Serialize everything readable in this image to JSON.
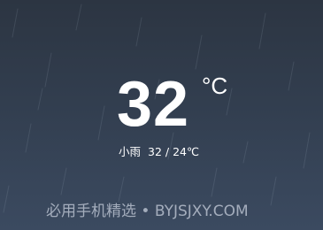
{
  "weather": {
    "temperature": "32",
    "unit": "°C",
    "condition": "小雨",
    "range": "32 / 24℃"
  },
  "watermark": {
    "text": "必用手机精选 • BYJSJXY.COM"
  },
  "colors": {
    "background_top": "#2c3542",
    "background_bottom": "#3b4a60",
    "text": "#ffffff"
  }
}
